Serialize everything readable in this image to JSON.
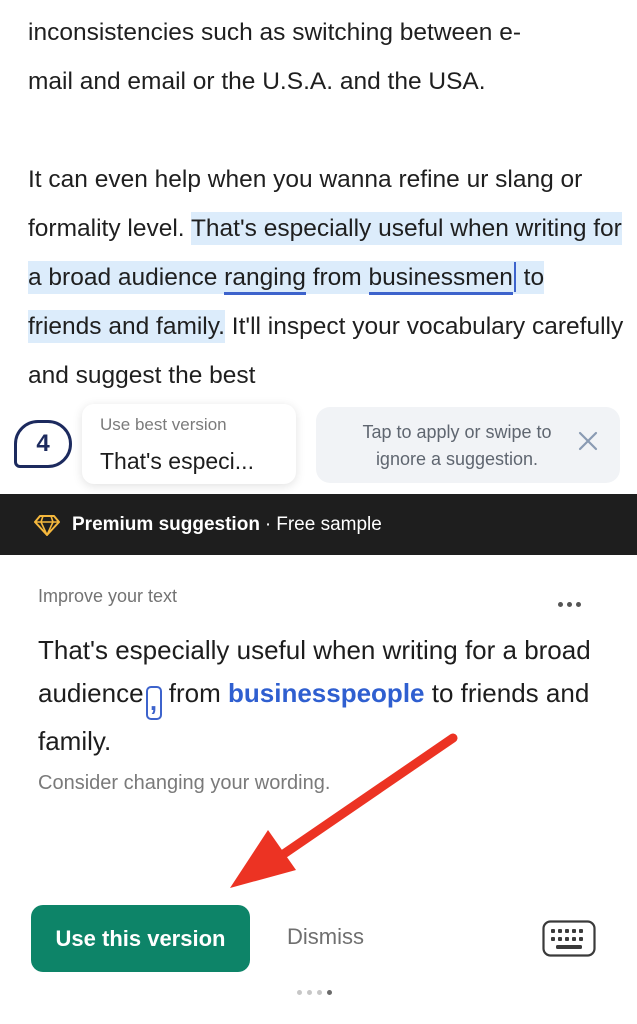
{
  "document": {
    "line1": "inconsistencies such as switching between e-",
    "line2": "mail and email or the U.S.A. and the USA.",
    "p2_before": "It can even help when you wanna refine ur slang or formality level. ",
    "p2_hl_1": "That's especially useful when writing for a broad audience ",
    "p2_hl_ranging": "ranging",
    "p2_hl_2": " from ",
    "p2_hl_business": "businessmen",
    "p2_hl_3": " to friends and family.",
    "p2_after": " It'll inspect your vocabulary carefully and suggest the best"
  },
  "badge": {
    "count": "4"
  },
  "mini_card": {
    "label": "Use best version",
    "value": "That's especi..."
  },
  "tip": {
    "text": "Tap to apply or swipe to ignore a suggestion."
  },
  "premium": {
    "title": "Premium suggestion",
    "separator": "·",
    "free": "Free sample"
  },
  "card": {
    "header": "Improve your text",
    "s1": "That's especially useful when writing for a broad audience",
    "comma": ",",
    "s2": " from ",
    "replacement": "businesspeople",
    "s3": " to friends and family.",
    "hint": "Consider changing your wording."
  },
  "actions": {
    "use_label": "Use this version",
    "dismiss_label": "Dismiss"
  },
  "icons": {
    "premium": "diamond-icon",
    "close": "close-icon",
    "more": "more-icon",
    "keyboard": "keyboard-icon",
    "arrow": "arrow-annotation-icon"
  },
  "colors": {
    "accent_blue": "#3d63cc",
    "highlight": "#dcecfb",
    "primary_green": "#0d8468",
    "premium_bar": "#1e1e1e",
    "gem": "#f5b83d",
    "arrow_red": "#ec3323"
  }
}
